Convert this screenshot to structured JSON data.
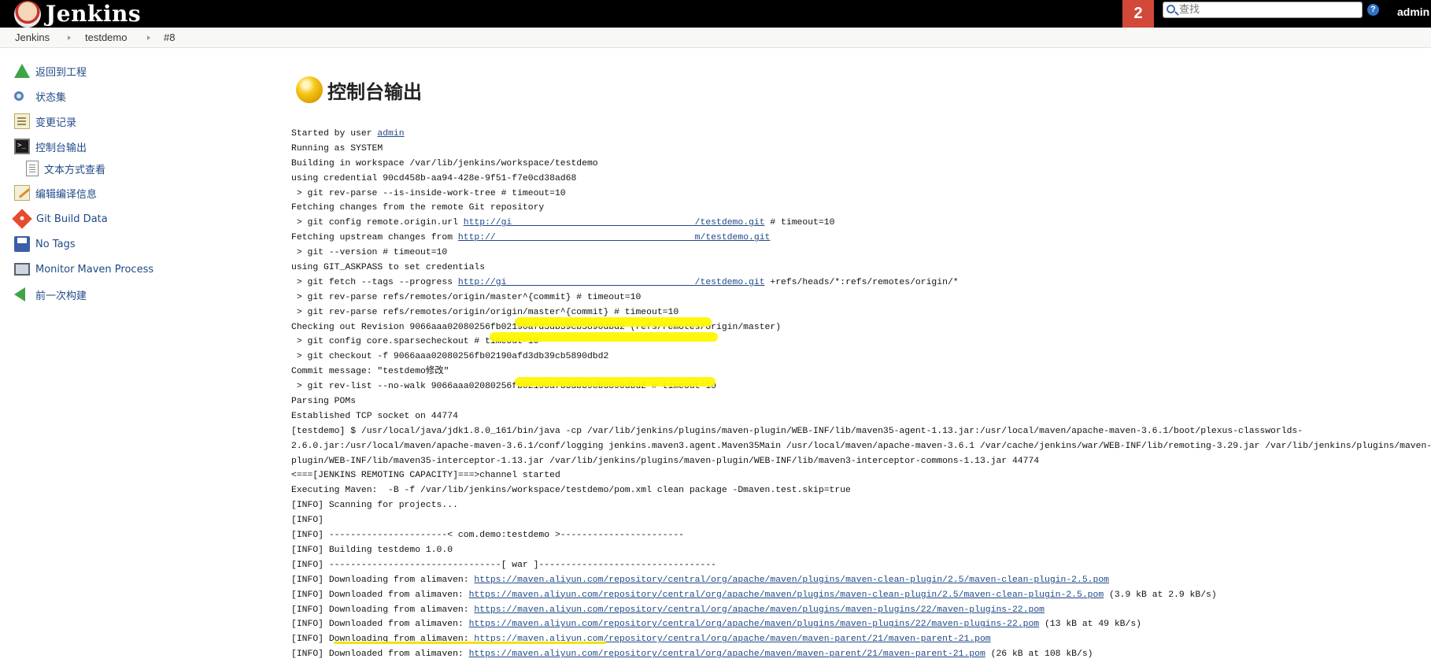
{
  "header": {
    "logo_text": "Jenkins",
    "notification_count": "2",
    "search_placeholder": "查找",
    "help_label": "?",
    "user": "admin"
  },
  "breadcrumb": [
    "Jenkins",
    "testdemo",
    "#8"
  ],
  "side_panel": {
    "items": [
      {
        "label": "返回到工程",
        "icon": "up-arrow-icon"
      },
      {
        "label": "状态集",
        "icon": "magnifier-icon"
      },
      {
        "label": "变更记录",
        "icon": "notepad-icon"
      },
      {
        "label": "控制台输出",
        "icon": "terminal-icon",
        "active": true
      },
      {
        "label": "文本方式查看",
        "icon": "document-icon",
        "sub": true
      },
      {
        "label": "编辑编译信息",
        "icon": "edit-icon"
      },
      {
        "label": "Git Build Data",
        "icon": "git-icon"
      },
      {
        "label": "No Tags",
        "icon": "disk-icon"
      },
      {
        "label": "Monitor Maven Process",
        "icon": "monitor-icon"
      },
      {
        "label": "前一次构建",
        "icon": "left-arrow-icon"
      }
    ]
  },
  "main": {
    "title": "控制台输出",
    "console": [
      {
        "text": "Started by user ",
        "link": "admin",
        "after": ""
      },
      {
        "text": "Running as SYSTEM"
      },
      {
        "text": "Building in workspace /var/lib/jenkins/workspace/testdemo"
      },
      {
        "text": "using credential 90cd458b-aa94-428e-9f51-f7e0cd38ad68"
      },
      {
        "text": " > git rev-parse --is-inside-work-tree # timeout=10"
      },
      {
        "text": "Fetching changes from the remote Git repository"
      },
      {
        "text": " > git config remote.origin.url ",
        "link": "http://gi                                  /testdemo.git",
        "after": " # timeout=10"
      },
      {
        "text": "Fetching upstream changes from ",
        "link": "http://                                     m/testdemo.git",
        "after": ""
      },
      {
        "text": " > git --version # timeout=10"
      },
      {
        "text": "using GIT_ASKPASS to set credentials"
      },
      {
        "text": " > git fetch --tags --progress ",
        "link": "http://gi                                   /testdemo.git",
        "after": " +refs/heads/*:refs/remotes/origin/*"
      },
      {
        "text": " > git rev-parse refs/remotes/origin/master^{commit} # timeout=10"
      },
      {
        "text": " > git rev-parse refs/remotes/origin/origin/master^{commit} # timeout=10"
      },
      {
        "text": "Checking out Revision 9066aaa02080256fb02190afd3db39cb5890dbd2 (refs/remotes/origin/master)"
      },
      {
        "text": " > git config core.sparsecheckout # timeout=10"
      },
      {
        "text": " > git checkout -f 9066aaa02080256fb02190afd3db39cb5890dbd2"
      },
      {
        "text": "Commit message: \"testdemo修改\""
      },
      {
        "text": " > git rev-list --no-walk 9066aaa02080256fb02190afd3db39cb5890dbd2 # timeout=10"
      },
      {
        "text": "Parsing POMs"
      },
      {
        "text": "Established TCP socket on 44774"
      },
      {
        "text": "[testdemo] $ /usr/local/java/jdk1.8.0_161/bin/java -cp /var/lib/jenkins/plugins/maven-plugin/WEB-INF/lib/maven35-agent-1.13.jar:/usr/local/maven/apache-maven-3.6.1/boot/plexus-classworlds-"
      },
      {
        "text": "2.6.0.jar:/usr/local/maven/apache-maven-3.6.1/conf/logging jenkins.maven3.agent.Maven35Main /usr/local/maven/apache-maven-3.6.1 /var/cache/jenkins/war/WEB-INF/lib/remoting-3.29.jar /var/lib/jenkins/plugins/maven-"
      },
      {
        "text": "plugin/WEB-INF/lib/maven35-interceptor-1.13.jar /var/lib/jenkins/plugins/maven-plugin/WEB-INF/lib/maven3-interceptor-commons-1.13.jar 44774"
      },
      {
        "text": "<===[JENKINS REMOTING CAPACITY]===>channel started"
      },
      {
        "text": "Executing Maven:  -B -f /var/lib/jenkins/workspace/testdemo/pom.xml clean package -Dmaven.test.skip=true"
      },
      {
        "text": "[INFO] Scanning for projects..."
      },
      {
        "text": "[INFO]"
      },
      {
        "text": "[INFO] ----------------------< com.demo:testdemo >-----------------------"
      },
      {
        "text": "[INFO] Building testdemo 1.0.0"
      },
      {
        "text": "[INFO] --------------------------------[ war ]---------------------------------"
      },
      {
        "text": "[INFO] Downloading from alimaven: ",
        "link": "https://maven.aliyun.com/repository/central/org/apache/maven/plugins/maven-clean-plugin/2.5/maven-clean-plugin-2.5.pom",
        "after": ""
      },
      {
        "text": "[INFO] Downloaded from alimaven: ",
        "link": "https://maven.aliyun.com/repository/central/org/apache/maven/plugins/maven-clean-plugin/2.5/maven-clean-plugin-2.5.pom",
        "after": " (3.9 kB at 2.9 kB/s)"
      },
      {
        "text": "[INFO] Downloading from alimaven: ",
        "link": "https://maven.aliyun.com/repository/central/org/apache/maven/plugins/maven-plugins/22/maven-plugins-22.pom",
        "after": ""
      },
      {
        "text": "[INFO] Downloaded from alimaven: ",
        "link": "https://maven.aliyun.com/repository/central/org/apache/maven/plugins/maven-plugins/22/maven-plugins-22.pom",
        "after": " (13 kB at 49 kB/s)"
      },
      {
        "text": "[INFO] Downloading from alimaven: ",
        "link": "https://maven.aliyun.com/repository/central/org/apache/maven/maven-parent/21/maven-parent-21.pom",
        "after": ""
      },
      {
        "text": "[INFO] Downloaded from alimaven: ",
        "link": "https://maven.aliyun.com/repository/central/org/apache/maven/maven-parent/21/maven-parent-21.pom",
        "after": " (26 kB at 108 kB/s)"
      }
    ]
  },
  "colors": {
    "header_bg": "#000000",
    "badge_bg": "#d24939",
    "link": "#204a87",
    "highlight": "#fff700"
  }
}
